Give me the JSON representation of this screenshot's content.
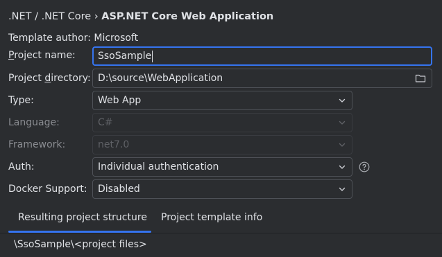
{
  "header": {
    "breadcrumb_1": ".NET / .NET Core",
    "separator": "›",
    "breadcrumb_2": "ASP.NET Core Web Application"
  },
  "template_author": "Template author: Microsoft",
  "project_name": {
    "label_mn": "P",
    "label_rest": "roject name:",
    "value": "SsoSample"
  },
  "project_directory": {
    "label_pre": "Project ",
    "label_mn": "d",
    "label_rest": "irectory:",
    "value": "D:\\source\\WebApplication",
    "icon": "folder-icon"
  },
  "type": {
    "label": "Type:",
    "value": "Web App"
  },
  "language": {
    "label": "Language:",
    "value": "C#",
    "enabled": false
  },
  "framework": {
    "label": "Framework:",
    "value": "net7.0",
    "enabled": false
  },
  "auth": {
    "label": "Auth:",
    "value": "Individual authentication",
    "help_icon": "help-icon"
  },
  "docker": {
    "label": "Docker Support:",
    "value": "Disabled"
  },
  "tabs": [
    {
      "label": "Resulting project structure",
      "active": true
    },
    {
      "label": "Project template info",
      "active": false
    }
  ],
  "result_structure": "\\SsoSample\\<project files>",
  "colors": {
    "background": "#2b2d30",
    "accent": "#3574f0",
    "text": "#dfe1e5",
    "text_disabled": "#5f6166",
    "border": "#4e5157"
  }
}
